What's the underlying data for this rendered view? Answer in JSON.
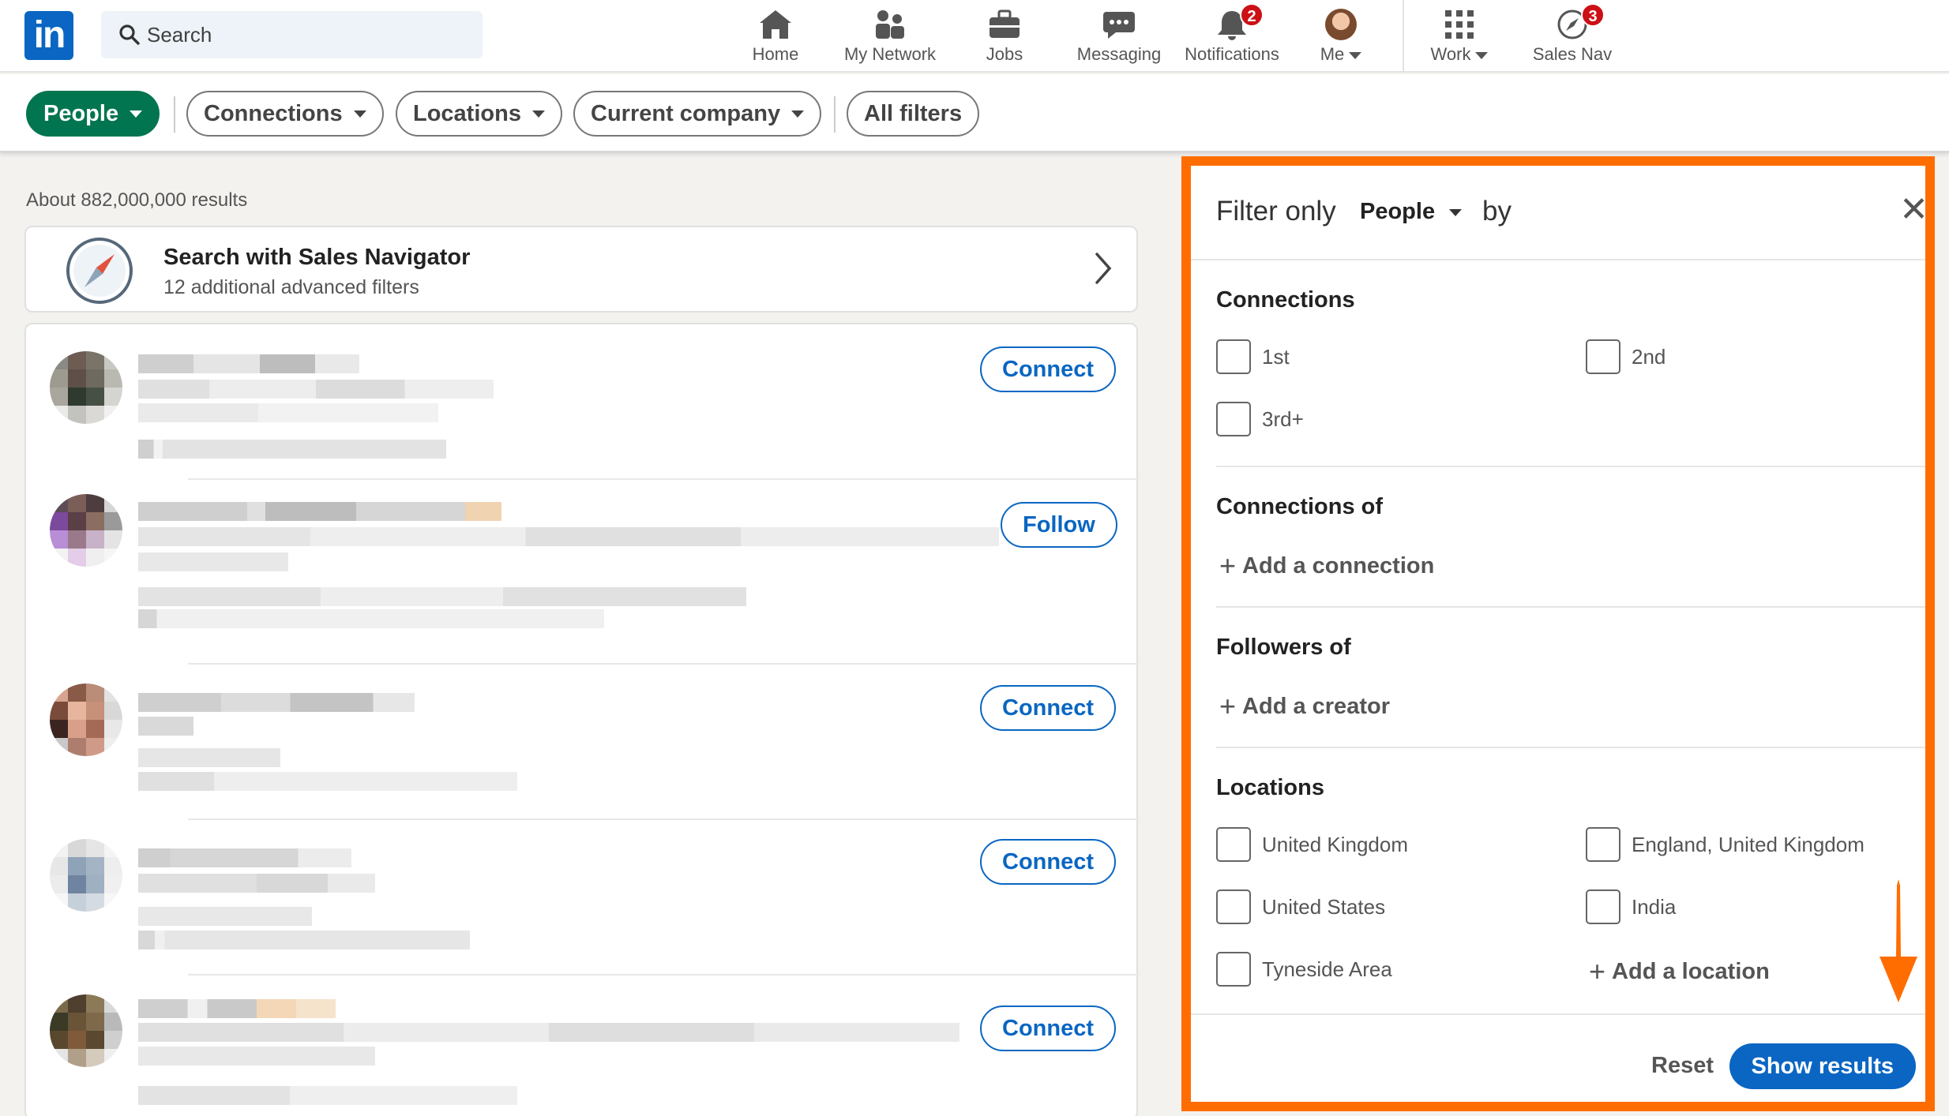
{
  "topnav": {
    "search_placeholder": "Search",
    "items": [
      {
        "label": "Home",
        "icon": "home-icon"
      },
      {
        "label": "My Network",
        "icon": "network-icon"
      },
      {
        "label": "Jobs",
        "icon": "briefcase-icon"
      },
      {
        "label": "Messaging",
        "icon": "messaging-icon"
      },
      {
        "label": "Notifications",
        "icon": "bell-icon",
        "badge": "2"
      },
      {
        "label": "Me",
        "icon": "avatar"
      },
      {
        "label": "Work",
        "icon": "grid-icon"
      },
      {
        "label": "Sales Nav",
        "icon": "compass-icon",
        "badge": "3"
      }
    ]
  },
  "filterbar": {
    "pills": [
      "People",
      "Connections",
      "Locations",
      "Current company",
      "All filters"
    ]
  },
  "results": {
    "count_text": "About 882,000,000 results",
    "salesnav_title": "Search with Sales Navigator",
    "salesnav_sub": "12 additional advanced filters",
    "rows": [
      {
        "action": "Connect"
      },
      {
        "action": "Follow"
      },
      {
        "action": "Connect"
      },
      {
        "action": "Connect"
      },
      {
        "action": "Connect"
      }
    ]
  },
  "panel": {
    "filter_only": "Filter only",
    "type": "People",
    "by": "by",
    "close": "✕",
    "connections_title": "Connections",
    "connections": [
      "1st",
      "2nd",
      "3rd+"
    ],
    "connections_of_title": "Connections of",
    "add_connection": "Add a connection",
    "followers_of_title": "Followers of",
    "add_creator": "Add a creator",
    "locations_title": "Locations",
    "locations": [
      "United Kingdom",
      "England, United Kingdom",
      "United States",
      "India",
      "Tyneside Area"
    ],
    "add_location": "Add a location",
    "reset": "Reset",
    "show_results": "Show results"
  },
  "colors": {
    "brand_blue": "#0a66c2",
    "active_green": "#01754f",
    "highlight_orange": "#ff6d00",
    "badge_red": "#cc1016"
  }
}
